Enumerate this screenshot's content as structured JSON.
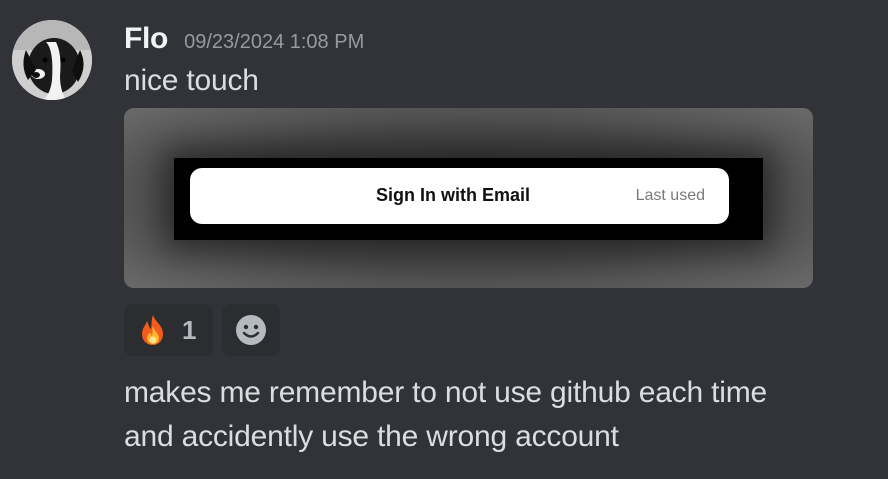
{
  "message": {
    "author": "Flo",
    "timestamp": "09/23/2024 1:08 PM",
    "first_line": "nice touch",
    "second_line_1": "makes me remember to not use github each time",
    "second_line_2": "and accidently use the wrong account"
  },
  "attachment": {
    "button_label": "Sign In with Email",
    "badge": "Last used"
  },
  "reactions": [
    {
      "emoji": "fire-icon",
      "count": "1"
    }
  ],
  "colors": {
    "background": "#313338",
    "reaction_bg": "#2b2d31",
    "muted": "#949ba4"
  }
}
